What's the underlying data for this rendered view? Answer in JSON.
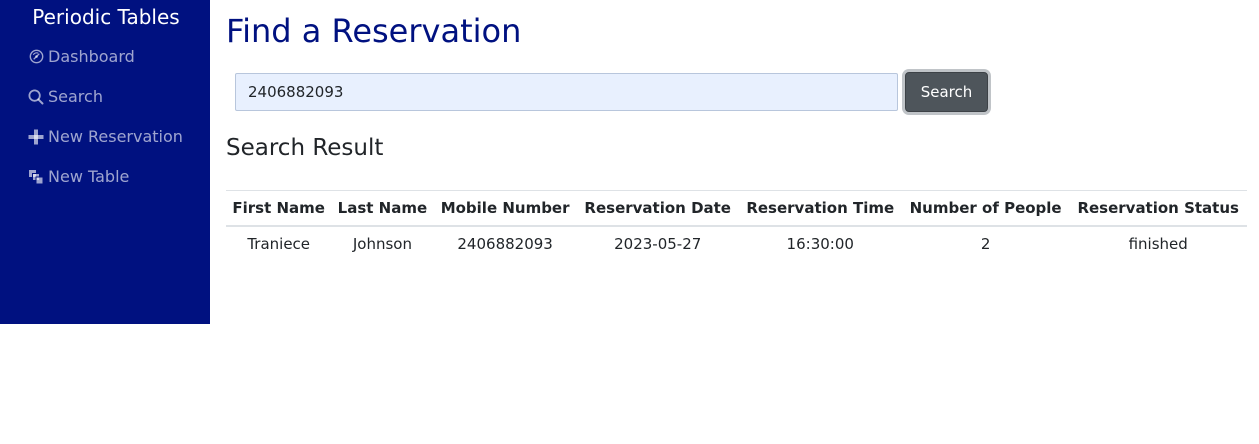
{
  "sidebar": {
    "brand": "Periodic Tables",
    "bg_color": "#001180",
    "items": [
      {
        "label": "Dashboard",
        "icon": "dashboard-icon"
      },
      {
        "label": "Search",
        "icon": "search-icon"
      },
      {
        "label": "New Reservation",
        "icon": "plus-icon"
      },
      {
        "label": "New Table",
        "icon": "layers-icon"
      }
    ]
  },
  "main": {
    "title": "Find a Reservation",
    "title_color": "#001180",
    "search": {
      "value": "2406882093",
      "placeholder": "",
      "button_label": "Search"
    },
    "result_heading": "Search Result",
    "table": {
      "columns": [
        "First Name",
        "Last Name",
        "Mobile Number",
        "Reservation Date",
        "Reservation Time",
        "Number of People",
        "Reservation Status"
      ],
      "rows": [
        [
          "Traniece",
          "Johnson",
          "2406882093",
          "2023-05-27",
          "16:30:00",
          "2",
          "finished"
        ]
      ]
    }
  }
}
